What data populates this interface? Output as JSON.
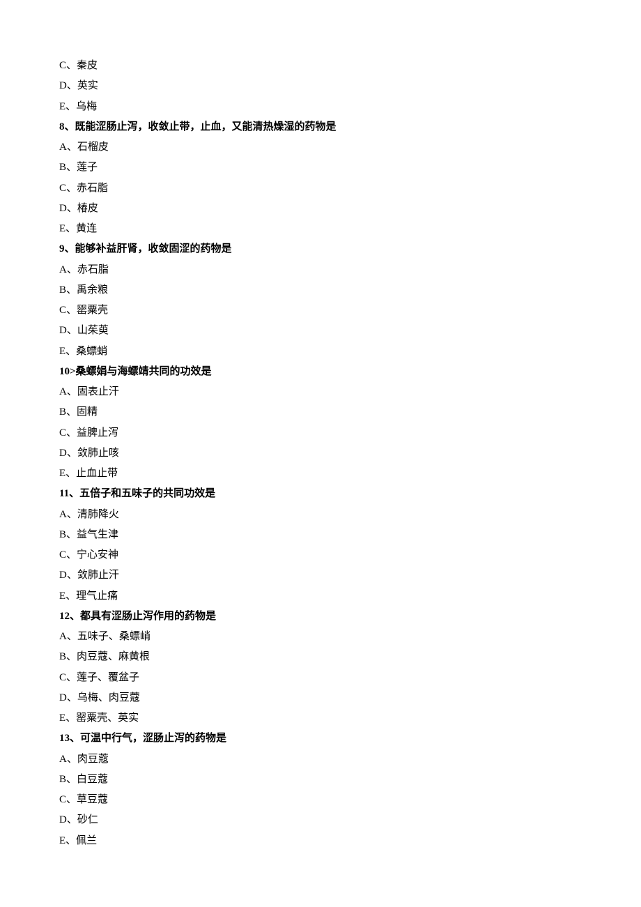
{
  "lines": [
    {
      "cls": "opt",
      "text": "C、秦皮"
    },
    {
      "cls": "opt",
      "text": "D、英实"
    },
    {
      "cls": "opt",
      "text": "E、乌梅"
    },
    {
      "cls": "q",
      "text": "8、既能涩肠止泻，收敛止带，止血，又能清热燥湿的药物是"
    },
    {
      "cls": "opt",
      "text": "A、石榴皮"
    },
    {
      "cls": "opt",
      "text": "B、莲子"
    },
    {
      "cls": "opt",
      "text": "C、赤石脂"
    },
    {
      "cls": "opt",
      "text": "D、椿皮"
    },
    {
      "cls": "opt",
      "text": "E、黄连"
    },
    {
      "cls": "q",
      "text": "9、能够补益肝肾，收敛固涩的药物是"
    },
    {
      "cls": "opt",
      "text": "A、赤石脂"
    },
    {
      "cls": "opt",
      "text": "B、禹余粮"
    },
    {
      "cls": "opt",
      "text": "C、罂粟壳"
    },
    {
      "cls": "opt",
      "text": "D、山茱萸"
    },
    {
      "cls": "opt",
      "text": "E、桑螵蛸"
    },
    {
      "cls": "q",
      "text": "10>桑螵娟与海螵靖共同的功效是"
    },
    {
      "cls": "opt",
      "text": "A、固表止汗"
    },
    {
      "cls": "opt",
      "text": "B、固精"
    },
    {
      "cls": "opt",
      "text": "C、益脾止泻"
    },
    {
      "cls": "opt",
      "text": "D、敛肺止咳"
    },
    {
      "cls": "opt",
      "text": "E、止血止带"
    },
    {
      "cls": "q",
      "text": "11、五倍子和五味子的共同功效是"
    },
    {
      "cls": "opt",
      "text": "A、清肺降火"
    },
    {
      "cls": "opt",
      "text": "B、益气生津"
    },
    {
      "cls": "opt",
      "text": "C、宁心安神"
    },
    {
      "cls": "opt",
      "text": "D、敛肺止汗"
    },
    {
      "cls": "opt",
      "text": "E、理气止痛"
    },
    {
      "cls": "q",
      "text": "12、都具有涩肠止泻作用的药物是"
    },
    {
      "cls": "opt",
      "text": "A、五味子、桑螵峭"
    },
    {
      "cls": "opt",
      "text": "B、肉豆蔻、麻黄根"
    },
    {
      "cls": "opt",
      "text": "C、莲子、覆盆子"
    },
    {
      "cls": "opt",
      "text": "D、乌梅、肉豆蔻"
    },
    {
      "cls": "opt",
      "text": "E、罂粟壳、英实"
    },
    {
      "cls": "q",
      "text": "13、可温中行气，涩肠止泻的药物是"
    },
    {
      "cls": "opt",
      "text": "A、肉豆蔻"
    },
    {
      "cls": "opt",
      "text": "B、白豆蔻"
    },
    {
      "cls": "opt",
      "text": "C、草豆蔻"
    },
    {
      "cls": "opt",
      "text": "D、砂仁"
    },
    {
      "cls": "opt",
      "text": "E、佩兰"
    }
  ]
}
